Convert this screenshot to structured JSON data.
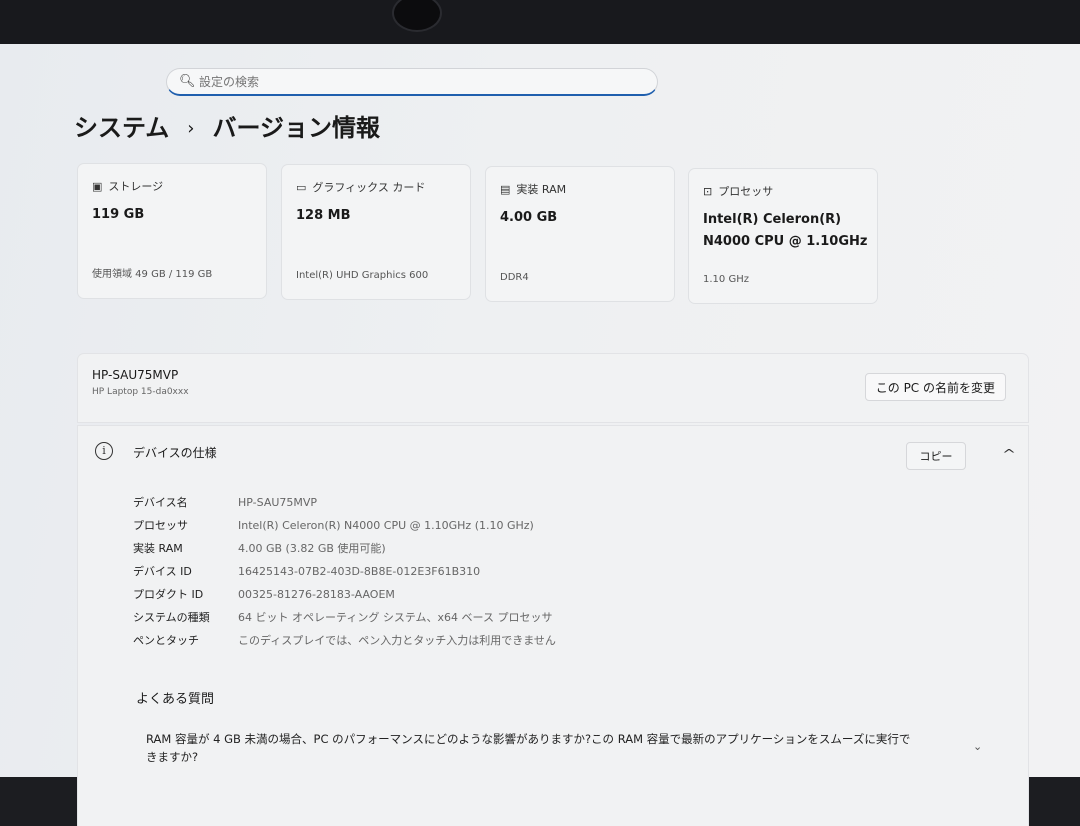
{
  "search": {
    "placeholder": "設定の検索"
  },
  "breadcrumb": {
    "parent": "システム",
    "separator": "›",
    "current": "バージョン情報"
  },
  "cards": [
    {
      "icon": "storage-icon",
      "label": "ストレージ",
      "value_lines": [
        "119 GB"
      ],
      "sub": "使用領域 49 GB / 119 GB"
    },
    {
      "icon": "graphics-card-icon",
      "label": "グラフィックス カード",
      "value_lines": [
        "128 MB"
      ],
      "sub": "Intel(R) UHD Graphics 600"
    },
    {
      "icon": "ram-icon",
      "label": "実装 RAM",
      "value_lines": [
        "4.00 GB"
      ],
      "sub": "DDR4"
    },
    {
      "icon": "processor-icon",
      "label": "プロセッサ",
      "value_lines": [
        "Intel(R) Celeron(R)",
        "N4000 CPU @ 1.10GHz"
      ],
      "sub": "1.10 GHz"
    }
  ],
  "pc": {
    "name": "HP-SAU75MVP",
    "model": "HP Laptop 15-da0xxx",
    "rename_label": "この PC の名前を変更"
  },
  "specs": {
    "title": "デバイスの仕様",
    "copy_label": "コピー",
    "rows": [
      {
        "key": "デバイス名",
        "value": "HP-SAU75MVP"
      },
      {
        "key": "プロセッサ",
        "value": "Intel(R) Celeron(R) N4000 CPU @ 1.10GHz (1.10 GHz)"
      },
      {
        "key": "実装 RAM",
        "value": "4.00 GB (3.82 GB 使用可能)"
      },
      {
        "key": "デバイス ID",
        "value": "16425143-07B2-403D-8B8E-012E3F61B310"
      },
      {
        "key": "プロダクト ID",
        "value": "00325-81276-28183-AAOEM"
      },
      {
        "key": "システムの種類",
        "value": "64 ビット オペレーティング システム、x64 ベース プロセッサ"
      },
      {
        "key": "ペンとタッチ",
        "value": "このディスプレイでは、ペン入力とタッチ入力は利用できません"
      }
    ]
  },
  "faq": {
    "title": "よくある質問",
    "question": "RAM 容量が 4 GB 未満の場合、PC のパフォーマンスにどのような影響がありますか?この RAM 容量で最新のアプリケーションをスムーズに実行できますか?"
  }
}
